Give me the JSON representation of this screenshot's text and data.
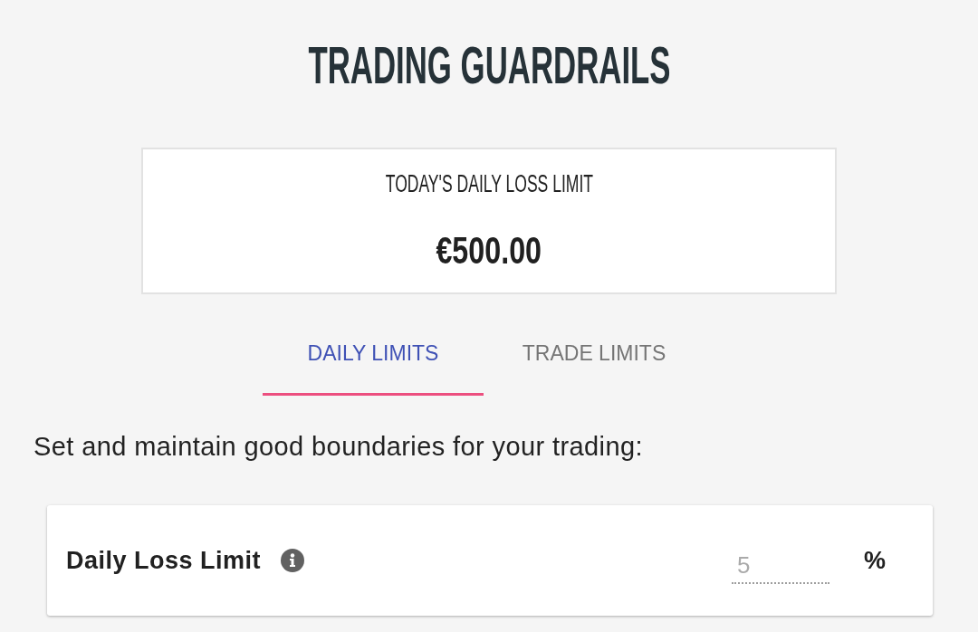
{
  "title": "TRADING GUARDRAILS",
  "summary": {
    "label": "TODAY'S DAILY LOSS LIMIT",
    "amount": "€500.00"
  },
  "tabs": [
    {
      "label": "DAILY LIMITS",
      "selected": true
    },
    {
      "label": "TRADE LIMITS",
      "selected": false
    }
  ],
  "intro": "Set and maintain good boundaries for your trading:",
  "settings": [
    {
      "label": "Daily Loss Limit",
      "placeholder": "5",
      "unit": "%"
    }
  ]
}
